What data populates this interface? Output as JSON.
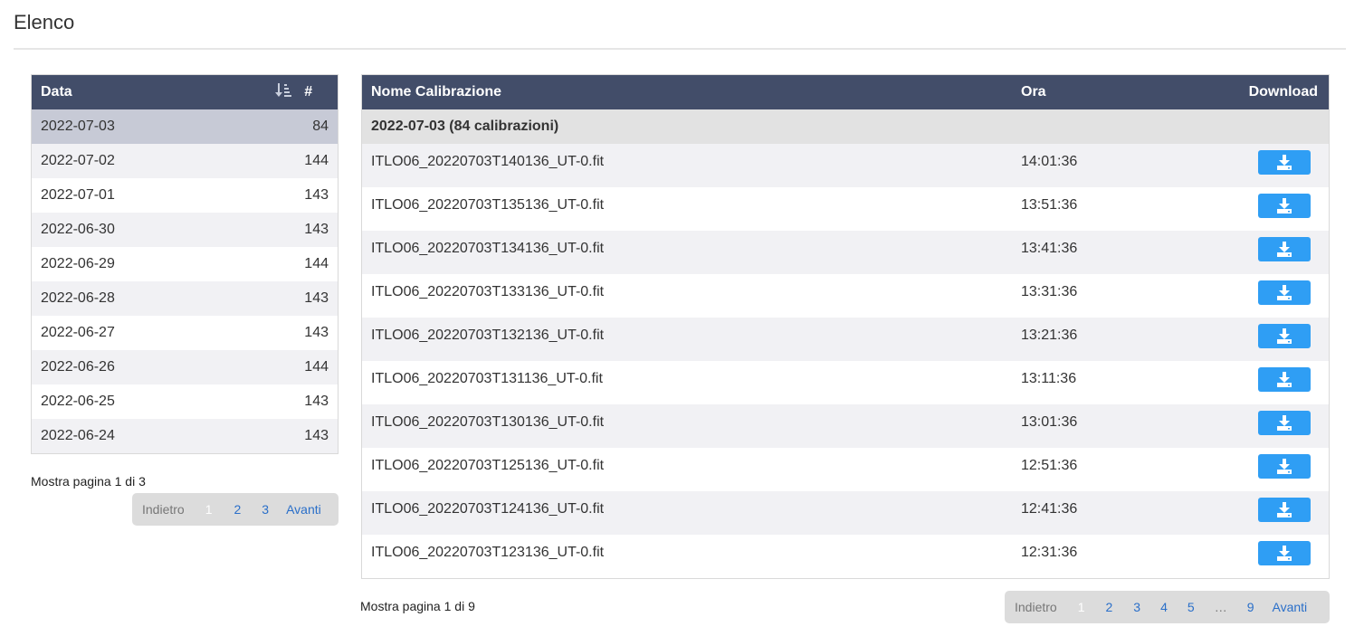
{
  "page": {
    "title": "Elenco"
  },
  "dates_table": {
    "headers": {
      "date": "Data",
      "count": "#"
    },
    "rows": [
      {
        "date": "2022-07-03",
        "count": "84"
      },
      {
        "date": "2022-07-02",
        "count": "144"
      },
      {
        "date": "2022-07-01",
        "count": "143"
      },
      {
        "date": "2022-06-30",
        "count": "143"
      },
      {
        "date": "2022-06-29",
        "count": "144"
      },
      {
        "date": "2022-06-28",
        "count": "143"
      },
      {
        "date": "2022-06-27",
        "count": "143"
      },
      {
        "date": "2022-06-26",
        "count": "144"
      },
      {
        "date": "2022-06-25",
        "count": "143"
      },
      {
        "date": "2022-06-24",
        "count": "143"
      }
    ],
    "selected_index": 0,
    "pager": {
      "info": "Mostra pagina 1 di 3",
      "prev": "Indietro",
      "pages": [
        "1",
        "2",
        "3"
      ],
      "next": "Avanti"
    }
  },
  "files_table": {
    "headers": {
      "name": "Nome Calibrazione",
      "time": "Ora",
      "download": "Download"
    },
    "group_label": "2022-07-03 (84 calibrazioni)",
    "rows": [
      {
        "name": "ITLO06_20220703T140136_UT-0.fit",
        "time": "14:01:36"
      },
      {
        "name": "ITLO06_20220703T135136_UT-0.fit",
        "time": "13:51:36"
      },
      {
        "name": "ITLO06_20220703T134136_UT-0.fit",
        "time": "13:41:36"
      },
      {
        "name": "ITLO06_20220703T133136_UT-0.fit",
        "time": "13:31:36"
      },
      {
        "name": "ITLO06_20220703T132136_UT-0.fit",
        "time": "13:21:36"
      },
      {
        "name": "ITLO06_20220703T131136_UT-0.fit",
        "time": "13:11:36"
      },
      {
        "name": "ITLO06_20220703T130136_UT-0.fit",
        "time": "13:01:36"
      },
      {
        "name": "ITLO06_20220703T125136_UT-0.fit",
        "time": "12:51:36"
      },
      {
        "name": "ITLO06_20220703T124136_UT-0.fit",
        "time": "12:41:36"
      },
      {
        "name": "ITLO06_20220703T123136_UT-0.fit",
        "time": "12:31:36"
      }
    ],
    "download_icon": "download-icon",
    "pager": {
      "info": "Mostra pagina 1 di 9",
      "prev": "Indietro",
      "pages": [
        "1",
        "2",
        "3",
        "4",
        "5",
        "…",
        "9"
      ],
      "next": "Avanti"
    }
  },
  "colors": {
    "header_bg": "#424d69",
    "selected_row_bg": "#c7cad6",
    "download_button": "#2f9ef4",
    "pager_bg": "#dcdcdc",
    "link": "#2a6fc9"
  }
}
